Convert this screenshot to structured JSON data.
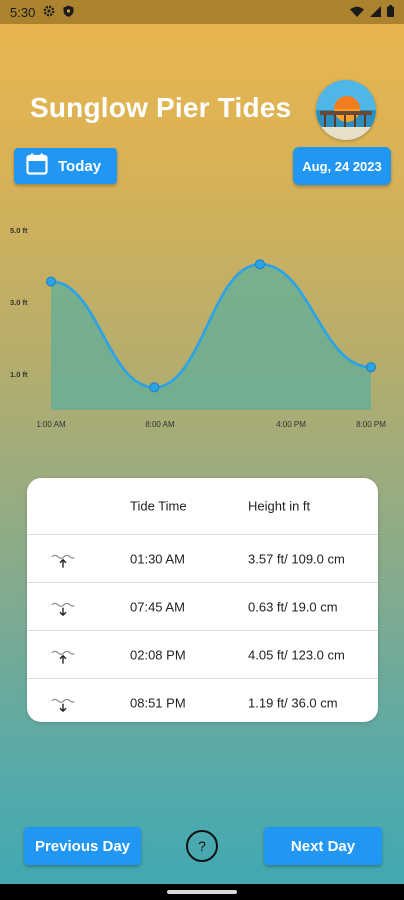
{
  "status_bar": {
    "time": "5:30",
    "icons": [
      "gear-icon",
      "shield-icon",
      "wifi-icon",
      "signal-icon",
      "battery-icon"
    ]
  },
  "header": {
    "title": "Sunglow Pier Tides",
    "logo_icon": "beach-pier-logo"
  },
  "controls": {
    "today_label": "Today",
    "date_label": "Aug, 24 2023"
  },
  "chart_data": {
    "type": "area",
    "x": [
      "1:00 AM",
      "8:00 AM",
      "4:00 PM",
      "8:00 PM"
    ],
    "y_ticks": [
      "5.0 ft",
      "3.0 ft",
      "1.0 ft"
    ],
    "points": [
      {
        "time": "01:30 AM",
        "height": 3.57
      },
      {
        "time": "07:45 AM",
        "height": 0.63
      },
      {
        "time": "02:08 PM",
        "height": 4.05
      },
      {
        "time": "08:51 PM",
        "height": 1.19
      }
    ],
    "ylim": [
      0,
      5
    ],
    "line_color": "#2aa3e8",
    "fill_color": "#5faf9b"
  },
  "tide_table": {
    "headers": {
      "icon": "",
      "time": "Tide Time",
      "height": "Height in ft"
    },
    "rows": [
      {
        "direction": "high",
        "icon": "wave-up-icon",
        "time": "01:30 AM",
        "height": "3.57 ft/ 109.0 cm"
      },
      {
        "direction": "low",
        "icon": "wave-down-icon",
        "time": "07:45 AM",
        "height": "0.63 ft/ 19.0 cm"
      },
      {
        "direction": "high",
        "icon": "wave-up-icon",
        "time": "02:08 PM",
        "height": "4.05 ft/ 123.0 cm"
      },
      {
        "direction": "low",
        "icon": "wave-down-icon",
        "time": "08:51 PM",
        "height": "1.19 ft/ 36.0 cm"
      }
    ]
  },
  "footer": {
    "prev_label": "Previous Day",
    "help_label": "?",
    "next_label": "Next Day"
  },
  "colors": {
    "button": "#2196f3",
    "title": "#ffffff",
    "background_top": "#eab64e",
    "background_bottom": "#3fa8b4"
  }
}
